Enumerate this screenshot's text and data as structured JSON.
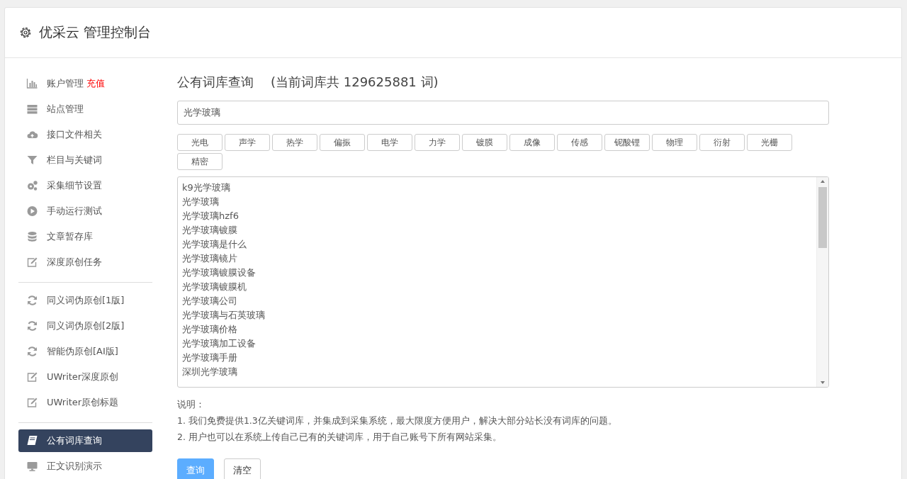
{
  "header": {
    "title": "优采云 管理控制台"
  },
  "sidebar": {
    "groups": [
      [
        {
          "kind": "chart",
          "label": "账户管理",
          "badge": "充值",
          "selected": false
        },
        {
          "kind": "server",
          "label": "站点管理",
          "selected": false
        },
        {
          "kind": "cloud",
          "label": "接口文件相关",
          "selected": false
        },
        {
          "kind": "filter",
          "label": "栏目与关键词",
          "selected": false
        },
        {
          "kind": "gears",
          "label": "采集细节设置",
          "selected": false
        },
        {
          "kind": "play",
          "label": "手动运行测试",
          "selected": false
        },
        {
          "kind": "database",
          "label": "文章暂存库",
          "selected": false
        },
        {
          "kind": "edit",
          "label": "深度原创任务",
          "selected": false
        }
      ],
      [
        {
          "kind": "refresh",
          "label": "同义词伪原创[1版]",
          "selected": false
        },
        {
          "kind": "refresh",
          "label": "同义词伪原创[2版]",
          "selected": false
        },
        {
          "kind": "refresh",
          "label": "智能伪原创[AI版]",
          "selected": false
        },
        {
          "kind": "edit",
          "label": "UWriter深度原创",
          "selected": false
        },
        {
          "kind": "edit",
          "label": "UWriter原创标题",
          "selected": false
        }
      ],
      [
        {
          "kind": "book",
          "label": "公有词库查询",
          "selected": true
        },
        {
          "kind": "monitor",
          "label": "正文识别演示",
          "selected": false
        }
      ]
    ]
  },
  "main": {
    "title": "公有词库查询",
    "count_note": "(当前词库共 129625881 词)",
    "search": {
      "value": "光学玻璃"
    },
    "tags": [
      "光电",
      "声学",
      "热学",
      "偏振",
      "电学",
      "力学",
      "镀膜",
      "成像",
      "传感",
      "铌酸锂",
      "物理",
      "衍射",
      "光栅",
      "精密"
    ],
    "results": [
      "k9光学玻璃",
      "光学玻璃",
      "光学玻璃hzf6",
      "光学玻璃镀膜",
      "光学玻璃是什么",
      "光学玻璃镜片",
      "光学玻璃镀膜设备",
      "光学玻璃镀膜机",
      "光学玻璃公司",
      "光学玻璃与石英玻璃",
      "光学玻璃价格",
      "光学玻璃加工设备",
      "光学玻璃手册",
      "深圳光学玻璃"
    ],
    "notes_title": "说明：",
    "notes": [
      "1. 我们免费提供1.3亿关键词库，并集成到采集系统，最大限度方便用户，解决大部分站长没有词库的问题。",
      "2. 用户也可以在系统上传自己已有的关键词库，用于自己账号下所有网站采集。"
    ],
    "buttons": [
      {
        "kind": "primary",
        "label": "查询"
      },
      {
        "kind": "default",
        "label": "清空"
      }
    ]
  }
}
